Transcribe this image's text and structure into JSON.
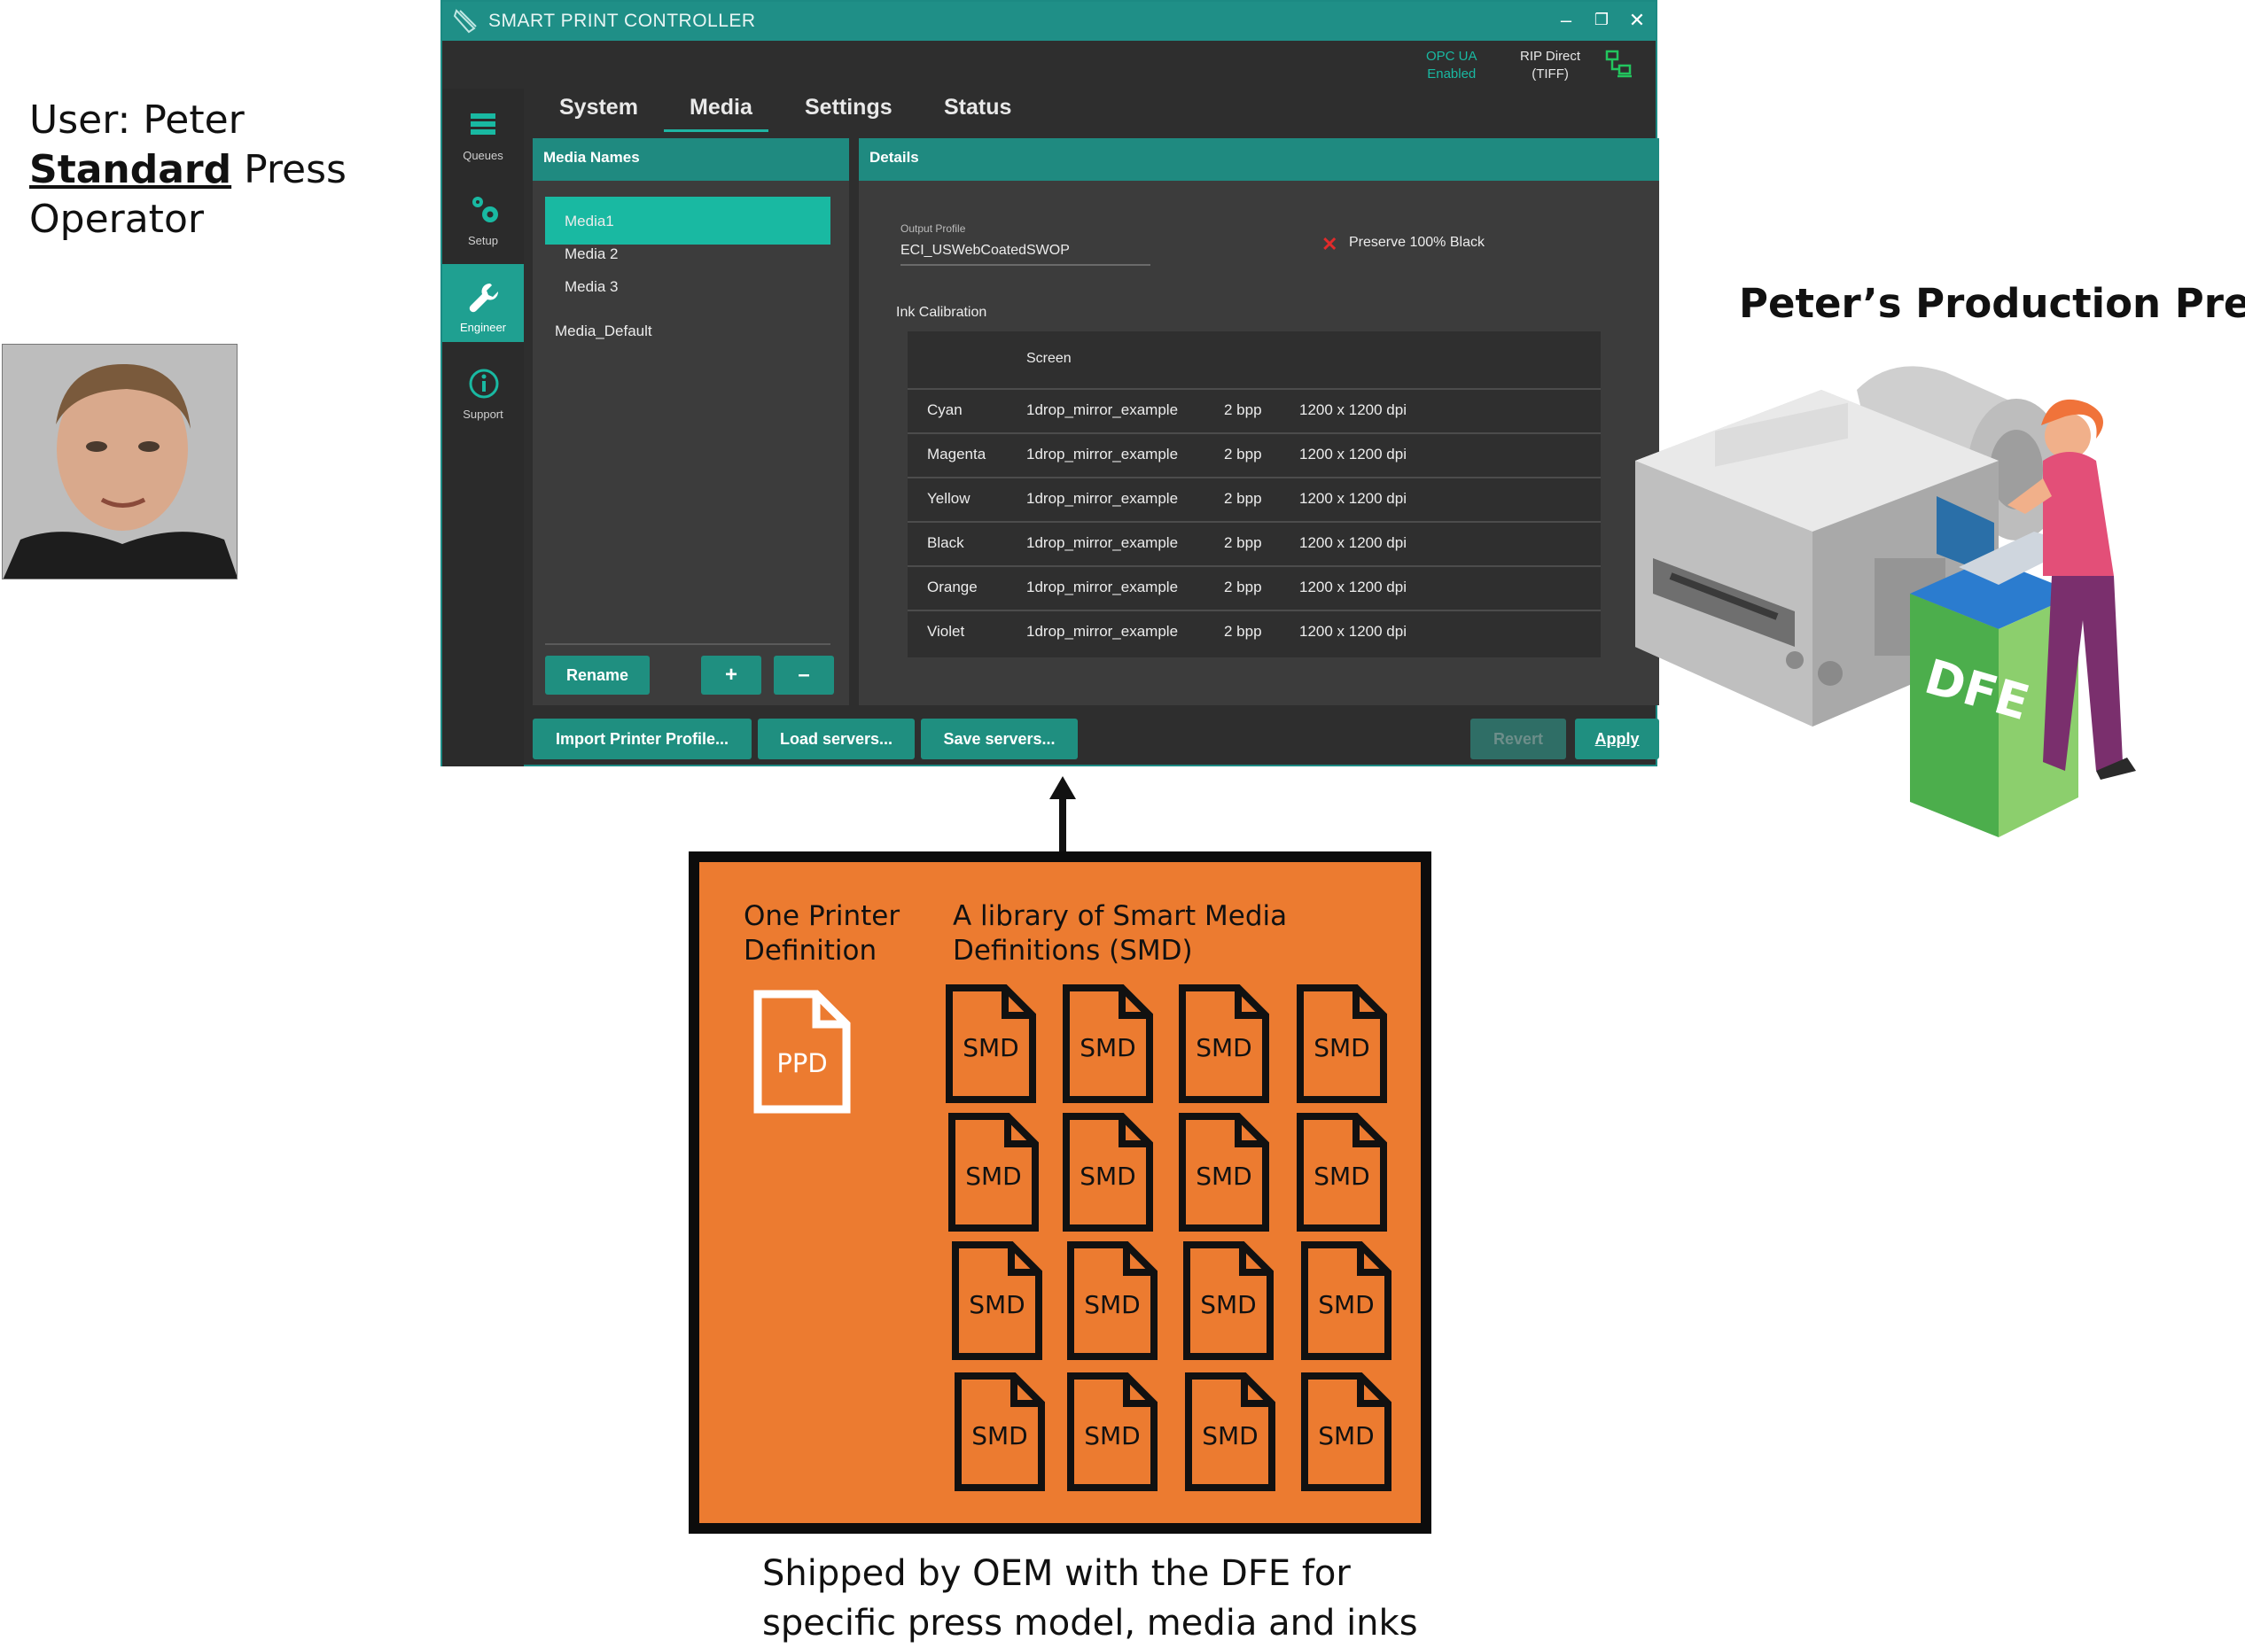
{
  "user": {
    "prefix": "User: Peter",
    "role_bold": "Standard",
    "role_rest": " Press",
    "line3": "Operator"
  },
  "window": {
    "title": "SMART PRINT CONTROLLER",
    "controls": [
      "–",
      "❐",
      "✕"
    ],
    "status_opc_line1": "OPC UA",
    "status_opc_line2": "Enabled",
    "status_rip_line1": "RIP Direct",
    "status_rip_line2": "(TIFF)"
  },
  "sidebar": {
    "items": [
      {
        "label": "Queues",
        "icon": "list-icon"
      },
      {
        "label": "Setup",
        "icon": "gears-icon"
      },
      {
        "label": "Engineer",
        "icon": "wrench-icon",
        "active": true
      },
      {
        "label": "Support",
        "icon": "info-icon"
      }
    ]
  },
  "tabs": [
    {
      "label": "System"
    },
    {
      "label": "Media",
      "active": true
    },
    {
      "label": "Settings"
    },
    {
      "label": "Status"
    }
  ],
  "media_panel": {
    "heading": "Media Names",
    "items": [
      "Media1",
      "Media 2",
      "Media 3"
    ],
    "default": "Media_Default",
    "rename": "Rename",
    "add": "+",
    "remove": "–"
  },
  "details": {
    "heading": "Details",
    "output_profile_label": "Output Profile",
    "output_profile_value": "ECI_USWebCoatedSWOP",
    "preserve_black": "Preserve 100% Black",
    "ink_calibration_label": "Ink Calibration",
    "screen_header": "Screen",
    "rows": [
      [
        "Cyan",
        "1drop_mirror_example",
        "2 bpp",
        "1200 x 1200 dpi"
      ],
      [
        "Magenta",
        "1drop_mirror_example",
        "2 bpp",
        "1200 x 1200 dpi"
      ],
      [
        "Yellow",
        "1drop_mirror_example",
        "2 bpp",
        "1200 x 1200 dpi"
      ],
      [
        "Black",
        "1drop_mirror_example",
        "2 bpp",
        "1200 x 1200 dpi"
      ],
      [
        "Orange",
        "1drop_mirror_example",
        "2 bpp",
        "1200 x 1200 dpi"
      ],
      [
        "Violet",
        "1drop_mirror_example",
        "2 bpp",
        "1200 x 1200 dpi"
      ]
    ]
  },
  "footer_buttons": {
    "import": "Import Printer Profile...",
    "load": "Load servers...",
    "save": "Save servers...",
    "revert": "Revert",
    "apply": "Apply"
  },
  "press": {
    "title": "Peter’s Production Press",
    "dfe_label": "DFE"
  },
  "library": {
    "printer_def_line1": "One Printer",
    "printer_def_line2": "Definition",
    "ppd_label": "PPD",
    "smd_line1": "A library of  Smart Media",
    "smd_line2": "Definitions (SMD)",
    "smd_label": "SMD",
    "smd_count": 16
  },
  "caption": {
    "line1": "Shipped by OEM with the DFE for",
    "line2": "specific press model, media and inks"
  }
}
